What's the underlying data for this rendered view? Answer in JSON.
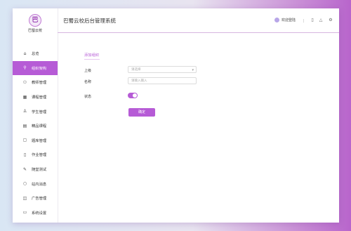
{
  "brand": {
    "logo_glyph": "巴",
    "logo_text": "巴蜀云校"
  },
  "header": {
    "title": "巴蜀云校后台管理系统",
    "user_name": "欢迎登陆",
    "separator": "|"
  },
  "sidebar": {
    "items": [
      {
        "label": "总览",
        "icon": "home-icon"
      },
      {
        "label": "组织架构",
        "icon": "org-icon",
        "active": true
      },
      {
        "label": "教师管理",
        "icon": "user-icon"
      },
      {
        "label": "课程管理",
        "icon": "calendar-icon"
      },
      {
        "label": "学生管理",
        "icon": "student-icon"
      },
      {
        "label": "精品课程",
        "icon": "file-icon"
      },
      {
        "label": "题库管理",
        "icon": "comment-icon"
      },
      {
        "label": "作业管理",
        "icon": "bookmark-icon"
      },
      {
        "label": "随堂测试",
        "icon": "edit-icon"
      },
      {
        "label": "站内消息",
        "icon": "message-icon"
      },
      {
        "label": "广告管理",
        "icon": "ad-icon"
      },
      {
        "label": "系统设置",
        "icon": "settings-icon"
      }
    ]
  },
  "form": {
    "section_title": "添加组织",
    "parent_label": "上级",
    "parent_placeholder": "请选择",
    "name_label": "名称",
    "name_placeholder": "请输入输入",
    "status_label": "状态",
    "status_on": true,
    "confirm_label": "确定"
  },
  "colors": {
    "accent": "#b65bd6"
  }
}
